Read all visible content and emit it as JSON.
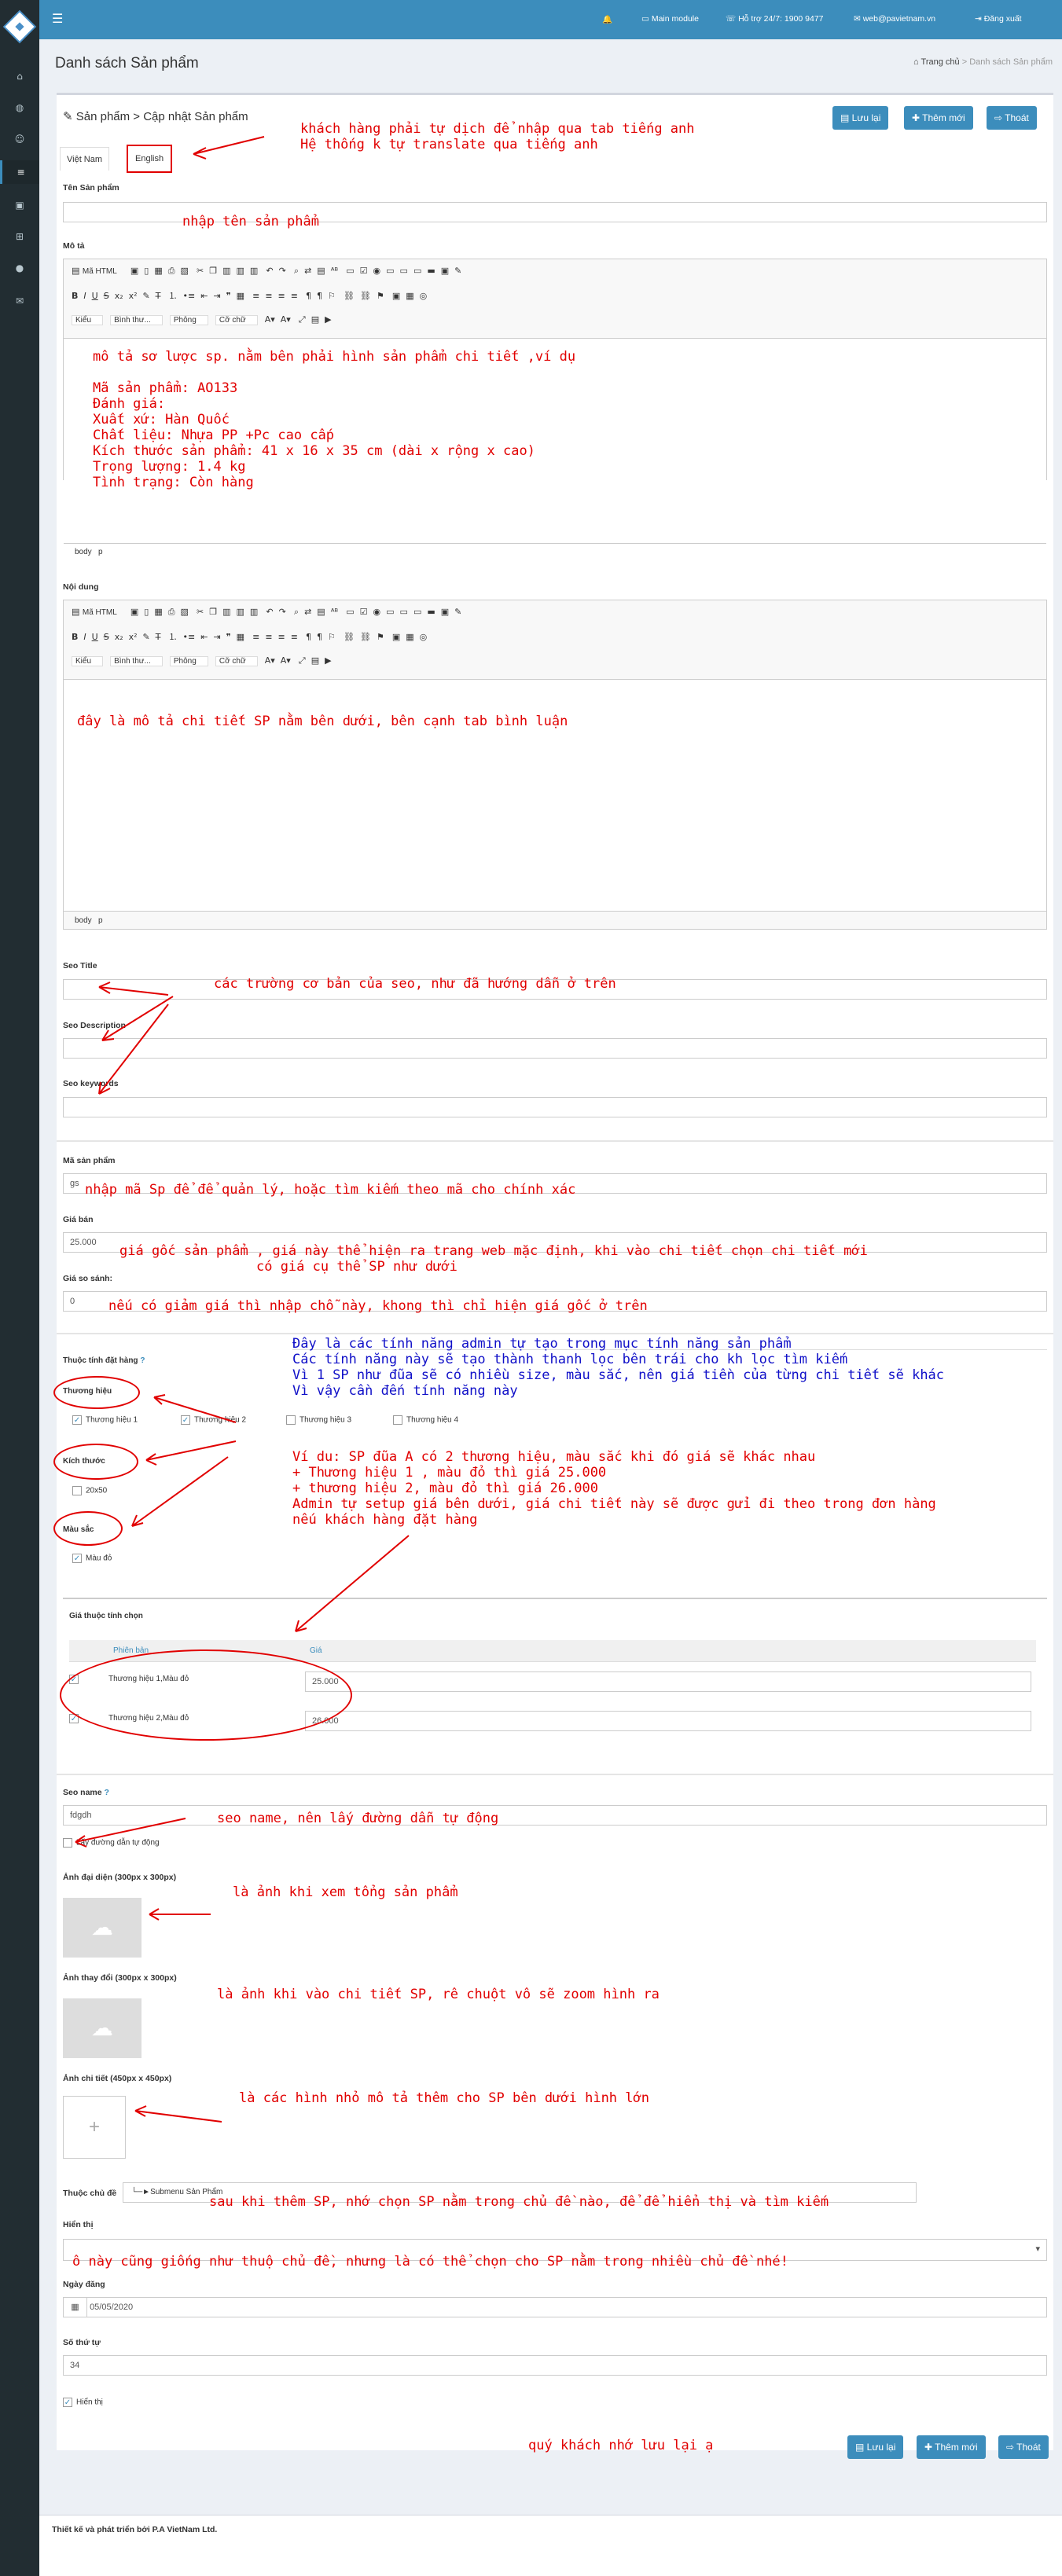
{
  "topbar": {
    "main_module": "Main module",
    "hotline": "Hỗ trợ 24/7: 1900 9477",
    "email": "web@pavietnam.vn",
    "logout": "Đăng xuất"
  },
  "page": {
    "title": "Danh sách Sản phẩm"
  },
  "breadcrumb": {
    "home": "Trang chủ",
    "current": "Danh sách Sản phẩm"
  },
  "card": {
    "title": "Sản phẩm > Cập nhật Sản phẩm"
  },
  "buttons": {
    "save": "Lưu lại",
    "add": "Thêm mới",
    "exit": "Thoát"
  },
  "tabs": [
    {
      "label": "Việt Nam"
    },
    {
      "label": "English"
    }
  ],
  "fields": {
    "product_name": "Tên Sản phẩm",
    "description": "Mô tả",
    "content": "Nội dung",
    "seo_title": "Seo Title",
    "seo_description": "Seo Description",
    "seo_keywords": "Seo keywords",
    "product_code": "Mã sản phẩm",
    "product_code_value": "gs",
    "price": "Giá bán",
    "price_value": "25.000",
    "compare_price": "Giá so sánh:",
    "compare_price_value": "0",
    "attributes": "Thuộc tính đặt hàng",
    "attr_brand": "Thương hiệu",
    "attr_size": "Kích thước",
    "attr_color": "Màu sắc",
    "attr_price_title": "Giá thuộc tính chọn",
    "seo_name": "Seo name",
    "seo_name_value": "fdgdh",
    "auto_path": "Lấy đường dẫn tự động",
    "avatar_img": "Ảnh đại diện (300px x 300px)",
    "hover_img": "Ảnh thay đổi (300px x 300px)",
    "detail_img": "Ảnh chi tiết (450px x 450px)",
    "category": "Thuộc chủ đề",
    "category_value": "└─►Submenu Sản Phẩm",
    "display": "Hiển thị",
    "date": "Ngày đăng",
    "date_value": "05/05/2020",
    "order": "Số thứ tự",
    "order_value": "34",
    "visible": "Hiển thị"
  },
  "editor": {
    "html_btn": "Mã HTML",
    "style": "Kiểu",
    "format": "Bình thư...",
    "font": "Phông",
    "size": "Cỡ chữ",
    "path_body": "body",
    "path_p": "p"
  },
  "brands": [
    "Thương hiệu 1",
    "Thương hiệu 2",
    "Thương hiệu 3",
    "Thương hiệu 4"
  ],
  "sizes": [
    "20x50"
  ],
  "colors": [
    "Màu đỏ"
  ],
  "attr_table": {
    "headers": [
      "Phiên bản",
      "Giá"
    ],
    "rows": [
      {
        "name": "Thương hiệu 1,Màu đỏ",
        "price": "25.000"
      },
      {
        "name": "Thương hiệu 2,Màu đỏ",
        "price": "26.000"
      }
    ]
  },
  "notes": {
    "translate": "khách hàng phải tự dịch để nhập qua tab tiếng anh\nHệ thống k tự translate qua tiếng anh",
    "name": "nhập tên sản phẩm",
    "desc": "mô tả sơ lược sp. nằm bên phải hình sản phẩm chi tiết ,ví dụ\n\nMã sản phẩm: AO133\nĐánh giá:\nXuất xứ: Hàn Quốc\nChất liệu: Nhựa PP +Pc cao cấp\nKích thước sản phẩm: 41 x 16 x 35 cm (dài x rộng x cao)\nTrọng lượng: 1.4 kg\nTình trạng: Còn hàng",
    "content": "đây là mô tả chi tiết SP nằm bên dưới, bên cạnh tab bình luận",
    "seo": "các trường cơ bản của seo, như đã hướng dẫn ở trên",
    "code": "nhập mã Sp để để quản lý, hoặc tìm kiếm theo mã cho chính xác",
    "price": "giá gốc sản phẩm , giá này thể hiện ra trang web mặc định, khi vào chi tiết chọn chi tiết mới\n                 có giá cụ thể SP như dưới",
    "compare": "nếu có giảm giá thì nhập chỗ này, khong thì chỉ hiện giá gốc ở trên",
    "attributes": "Đây là các tính năng admin tự tạo trong mục tính năng sản phẩm\nCác tính năng này sẽ tạo thành thanh lọc bên trái cho kh lọc tìm kiếm\nVì 1 SP như đũa sẽ có nhiều size, màu sắc, nên giá tiền của từng chi tiết sẽ khác\nVì vậy cần đến tính năng này",
    "example": "Ví du: SP đũa A có 2 thương hiệu, màu sắc khi đó giá sẽ khác nhau\n+ Thương hiệu 1 , màu đỏ thì giá 25.000\n+ thương hiệu 2, màu đỏ thì giá 26.000\nAdmin tự setup giá bên dưới, giá chi tiết này sẽ được gửi đi theo trong đơn hàng\nnếu khách hàng đặt hàng",
    "seo_name": "seo name, nên lấy đường dẫn tự động",
    "avatar": "là ảnh khi xem tổng sản phẩm",
    "hover": "là ảnh khi vào chi tiết SP, rê chuột vô sẽ zoom hình ra",
    "detail": "là các hình nhỏ mô tả thêm cho SP bên dưới hình lớn",
    "category": "sau khi thêm SP, nhớ chọn SP nằm trong chủ đề nào, để để hiển thị và tìm kiếm",
    "display": "ô này cũng giống như thuộ chủ đề, nhưng là có thể chọn cho SP nằm trong nhiều chủ đề nhé!",
    "save": "quý khách nhớ lưu lại ạ"
  },
  "footer": {
    "text": "Thiết kế và phát triển bởi P.A VietNam Ltd."
  },
  "icons": [
    "menu-icon",
    "bell-icon",
    "phone-icon",
    "mail-icon",
    "logout-icon",
    "home-icon",
    "save-icon",
    "plus-icon",
    "exit-icon",
    "edit-icon",
    "cloud-upload-icon",
    "calendar-icon",
    "question-icon"
  ],
  "colors_theme": {
    "primary": "#3c8dbc",
    "sidebar": "#222d32",
    "note_red": "#e10000",
    "note_blue": "#1010c8"
  }
}
